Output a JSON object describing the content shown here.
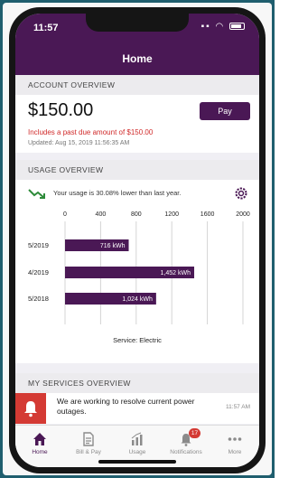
{
  "status_bar": {
    "time": "11:57"
  },
  "nav": {
    "title": "Home"
  },
  "account_overview": {
    "header": "ACCOUNT OVERVIEW",
    "amount": "$150.00",
    "pay_label": "Pay",
    "past_due": "Includes a past due amount of $150.00",
    "updated": "Updated: Aug 15, 2019 11:56:35 AM"
  },
  "usage_overview": {
    "header": "USAGE OVERVIEW",
    "comparison": "Your usage is 30.08% lower than last year.",
    "service_label": "Service: Electric"
  },
  "chart_data": {
    "type": "bar",
    "orientation": "horizontal",
    "categories": [
      "5/2019",
      "4/2019",
      "5/2018"
    ],
    "values": [
      716,
      1452,
      1024
    ],
    "value_labels": [
      "716 kWh",
      "1,452 kWh",
      "1,024 kWh"
    ],
    "x_ticks": [
      "0",
      "400",
      "800",
      "1200",
      "1600",
      "2000"
    ],
    "xlim": [
      0,
      2000
    ],
    "grid": true,
    "bar_color": "#4a1855"
  },
  "services_overview": {
    "header": "MY SERVICES OVERVIEW",
    "notice": "We are working to resolve current power outages.",
    "time": "11:57 AM"
  },
  "tabs": [
    {
      "label": "Home",
      "icon": "home-icon"
    },
    {
      "label": "Bill & Pay",
      "icon": "bill-icon"
    },
    {
      "label": "Usage",
      "icon": "usage-icon"
    },
    {
      "label": "Notifications",
      "icon": "bell-icon",
      "badge": "17"
    },
    {
      "label": "More",
      "icon": "more-icon"
    }
  ],
  "colors": {
    "brand": "#4a1855",
    "alert": "#d43a34",
    "past_due": "#d02a2a"
  }
}
